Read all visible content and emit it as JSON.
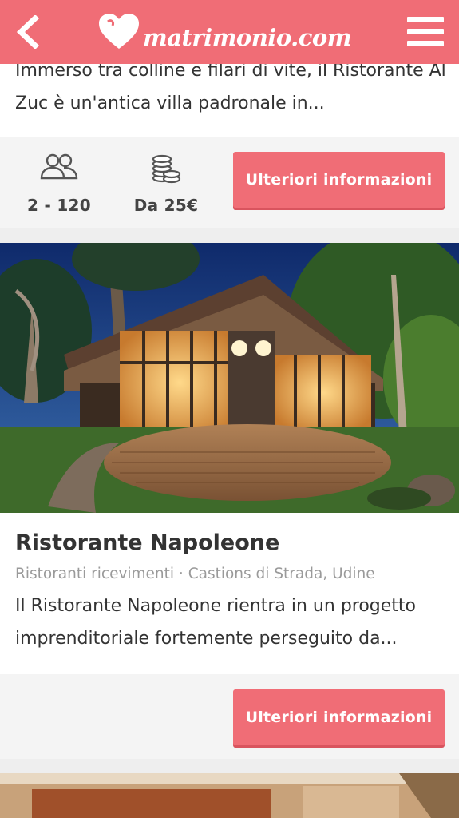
{
  "header": {
    "logo_text": "matrimonio.com",
    "brand_color": "#f06d76",
    "back_icon": "chevron-left-icon",
    "menu_icon": "hamburger-menu-icon"
  },
  "venues": [
    {
      "description": "Immerso tra colline e filari di vite, il Ristorante Al Zuc è un'antica villa padronale in...",
      "guests": "2 - 120",
      "price": "Da 25€",
      "guests_icon": "guests-icon",
      "price_icon": "coins-icon",
      "cta": "Ulteriori informazioni"
    },
    {
      "name": "Ristorante Napoleone",
      "category": "Ristoranti ricevimenti · Castions di Strada, Udine",
      "description": "Il Ristorante Napoleone rientra in un progetto imprenditoriale fortemente perseguito da...",
      "cta": "Ulteriori informazioni"
    }
  ]
}
